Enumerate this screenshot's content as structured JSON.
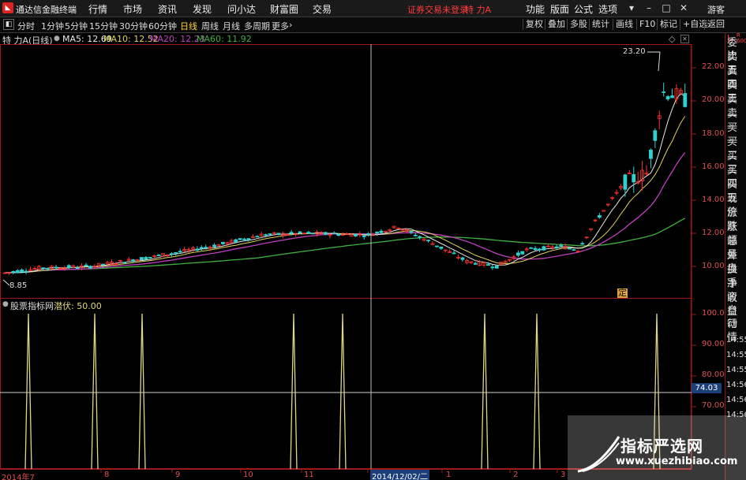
{
  "titlebar": {
    "app_title": "通达信金融终端",
    "menus": [
      "行情",
      "市场",
      "资讯",
      "发现",
      "问小达",
      "财富圈",
      "交易"
    ],
    "status": "证券交易未登录",
    "account": "特 力A",
    "right_menus": [
      "功能",
      "版面",
      "公式",
      "选项"
    ],
    "guest": "游客"
  },
  "toolbar": {
    "periods": [
      "分时",
      "1分钟",
      "5分钟",
      "15分钟",
      "30分钟",
      "60分钟",
      "日线",
      "周线",
      "月线",
      "多周期",
      "更多"
    ],
    "active_period": "日线",
    "right_buttons": [
      "复权",
      "叠加",
      "多股",
      "统计",
      "画线",
      "F10",
      "标记",
      "+自选",
      "返回"
    ]
  },
  "legend": {
    "stock": "特 力A",
    "period": "(日线)",
    "ma5": "MA5: 12.69",
    "ma10": "MA10: 12.52",
    "ma20": "MA20: 12.23",
    "ma60": "MA60: 11.92"
  },
  "colors": {
    "ma5": "#e8e8e8",
    "ma10": "#e0d25a",
    "ma20": "#c040c0",
    "ma60": "#40b040",
    "indicator": "#e0d880",
    "up": "#ff3030",
    "down": "#30d0d0",
    "axis": "#a01818"
  },
  "price_chart": {
    "high_label": "23.20",
    "low_label": "8.85",
    "y_ticks": [
      "22.00",
      "20.00",
      "18.00",
      "16.00",
      "14.00",
      "12.00",
      "10.00"
    ],
    "marker": "定"
  },
  "indicator": {
    "source": "股票指标网",
    "name": "潜伏: 50.00",
    "y_ticks": [
      "100.0",
      "90.00",
      "80.00",
      "70.00"
    ],
    "current_value": "74.03"
  },
  "x_axis": {
    "labels": [
      "2014年7",
      "8",
      "9",
      "10",
      "11",
      "2014/12/02/二",
      "1",
      "2",
      "3"
    ]
  },
  "sidebar": {
    "top_tag": "L",
    "top_small": "R 600",
    "items": [
      "委比",
      "卖五",
      "卖四",
      "卖三",
      "卖二",
      "卖一",
      "买一",
      "买二",
      "买三",
      "买四",
      "买五",
      "现价",
      "涨跌",
      "涨幅",
      "总量",
      "外盘",
      "换手",
      "净资",
      "收益",
      "自动",
      "行情"
    ],
    "times": [
      "14:55",
      "14:55",
      "14:55",
      "14:56",
      "14:56",
      "14:56"
    ]
  },
  "watermark": {
    "title": "指标严选网",
    "url": "www.xuezhibiao.com"
  }
}
